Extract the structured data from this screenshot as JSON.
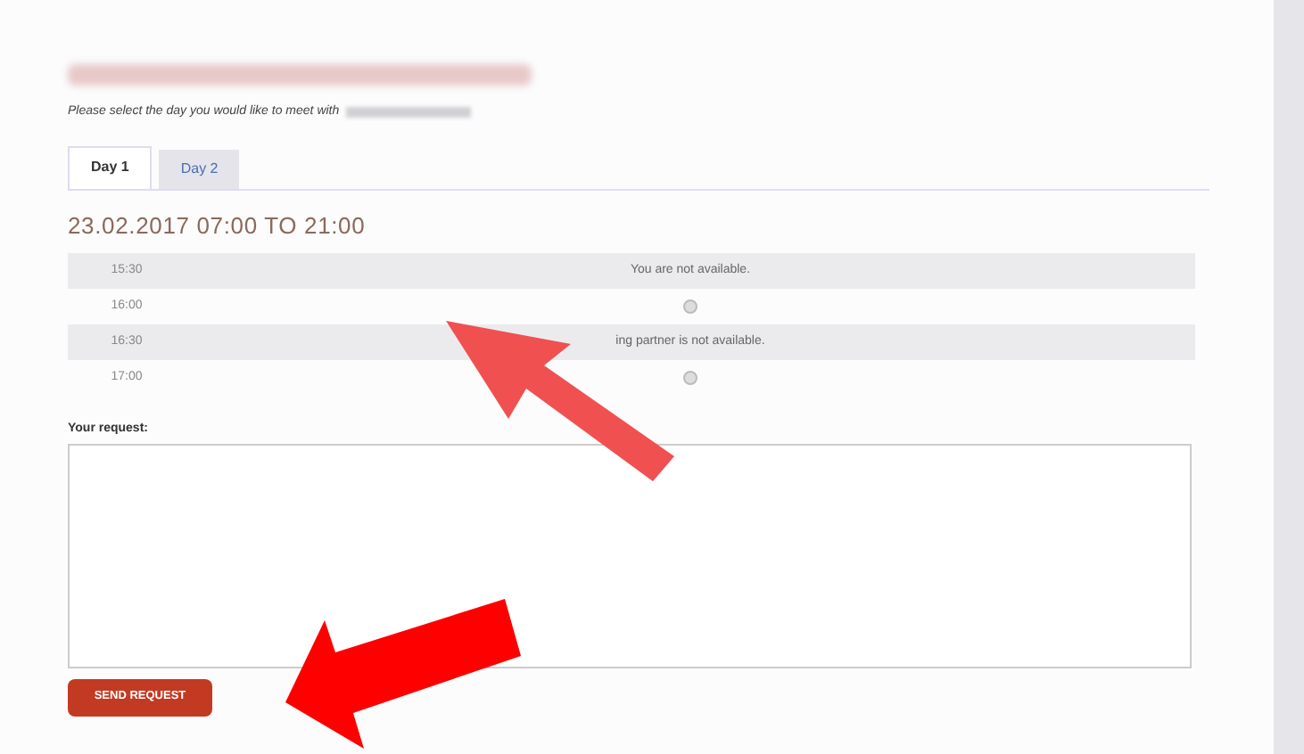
{
  "intro": "Please select the day you would like to meet with",
  "tabs": [
    {
      "label": "Day 1",
      "selected": true
    },
    {
      "label": "Day 2",
      "selected": false
    }
  ],
  "date_heading": "23.02.2017 07:00 TO 21:00",
  "slots": [
    {
      "time": "15:30",
      "kind": "message",
      "text": "You are not available."
    },
    {
      "time": "16:00",
      "kind": "radio",
      "selected": false
    },
    {
      "time": "16:30",
      "kind": "message",
      "text": "ing partner is not available."
    },
    {
      "time": "17:00",
      "kind": "radio",
      "selected": false
    }
  ],
  "request_label": "Your request:",
  "send_button": "SEND REQUEST"
}
